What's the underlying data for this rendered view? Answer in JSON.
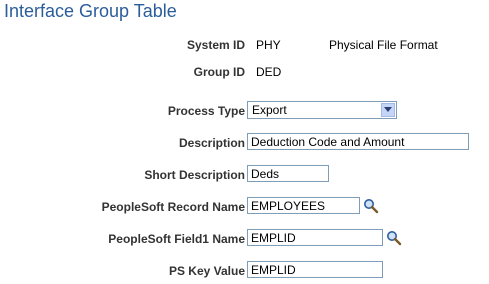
{
  "page": {
    "title": "Interface Group Table"
  },
  "system": {
    "label": "System ID",
    "value": "PHY",
    "description": "Physical File Format"
  },
  "group": {
    "label": "Group ID",
    "value": "DED"
  },
  "process_type": {
    "label": "Process Type",
    "selected": "Export"
  },
  "description": {
    "label": "Description",
    "value": "Deduction Code and Amount"
  },
  "short_description": {
    "label": "Short Description",
    "value": "Deds"
  },
  "record_name": {
    "label": "PeopleSoft Record Name",
    "value": "EMPLOYEES",
    "lookup_icon": "magnifier-icon"
  },
  "field1_name": {
    "label": "PeopleSoft Field1 Name",
    "value": "EMPLID",
    "lookup_icon": "magnifier-icon"
  },
  "ps_key_value": {
    "label": "PS Key Value",
    "value": "EMPLID"
  },
  "colors": {
    "title": "#2b5d9b",
    "field_border": "#7f9db9",
    "dropdown_button": "#c5d5f7"
  }
}
